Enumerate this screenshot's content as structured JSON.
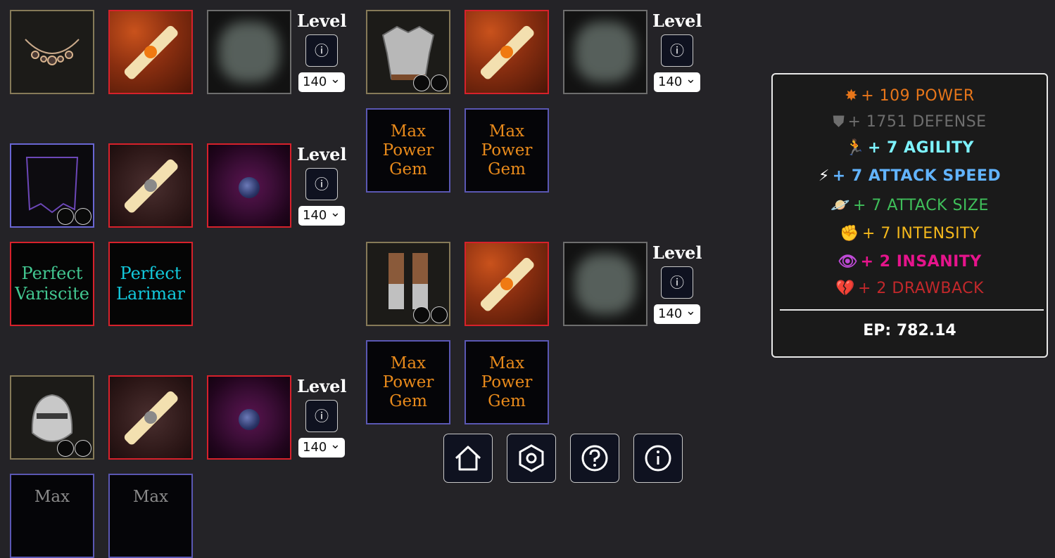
{
  "level": {
    "label": "Level",
    "info_icon": "info-circle-icon",
    "value": "140"
  },
  "gem_slots": {
    "max_power": [
      "Max",
      "Power",
      "Gem"
    ],
    "perfect_variscite": [
      "Perfect",
      "Variscite"
    ],
    "perfect_larimar": [
      "Perfect",
      "Larimar"
    ],
    "max_partial": "Max"
  },
  "nav": {
    "home": "home-icon",
    "settings": "hexagon-settings-icon",
    "help": "question-icon",
    "info": "info-icon"
  },
  "stats": {
    "power": "+ 109 POWER",
    "defense": "+ 1751 DEFENSE",
    "agility": "+ 7 AGILITY",
    "attack_speed": "+ 7 ATTACK SPEED",
    "attack_size": "+ 7 ATTACK SIZE",
    "intensity": "+ 7 INTENSITY",
    "insanity": "+ 2 INSANITY",
    "drawback": "+ 2 DRAWBACK",
    "ep": "EP: 782.14"
  },
  "colors": {
    "power": "#e8761a",
    "defense": "#6e6e6e",
    "agility": "#7df3ff",
    "attack_speed": "#62b4ff",
    "attack_size": "#3fbf5a",
    "intensity": "#f4b81c",
    "insanity": "#e6148c",
    "drawback": "#c2282b"
  }
}
